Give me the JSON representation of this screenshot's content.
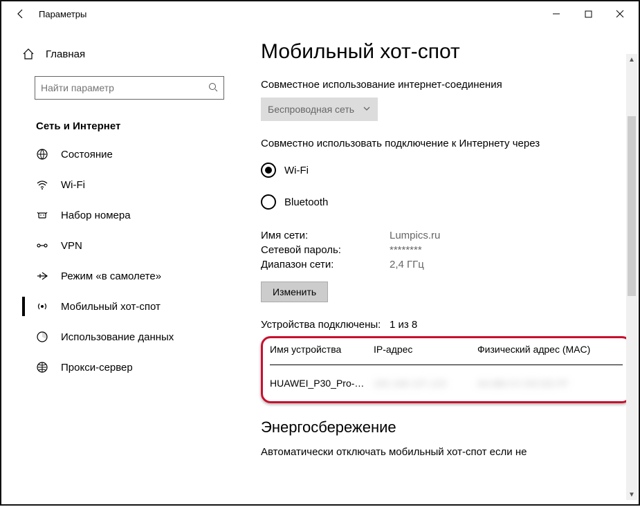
{
  "window": {
    "title": "Параметры"
  },
  "sidebar": {
    "home": "Главная",
    "search_placeholder": "Найти параметр",
    "category": "Сеть и Интернет",
    "items": [
      {
        "label": "Состояние",
        "iconKey": "status"
      },
      {
        "label": "Wi-Fi",
        "iconKey": "wifi"
      },
      {
        "label": "Набор номера",
        "iconKey": "dialup"
      },
      {
        "label": "VPN",
        "iconKey": "vpn"
      },
      {
        "label": "Режим «в самолете»",
        "iconKey": "airplane"
      },
      {
        "label": "Мобильный хот-спот",
        "iconKey": "hotspot"
      },
      {
        "label": "Использование данных",
        "iconKey": "datausage"
      },
      {
        "label": "Прокси-сервер",
        "iconKey": "proxy"
      }
    ]
  },
  "main": {
    "title": "Мобильный хот-спот",
    "share_connection_label": "Совместное использование интернет-соединения",
    "share_connection_value": "Беспроводная сеть",
    "share_over_label": "Совместно использовать подключение к Интернету через",
    "share_over_options": [
      {
        "label": "Wi-Fi",
        "selected": true
      },
      {
        "label": "Bluetooth",
        "selected": false
      }
    ],
    "network": {
      "name_label": "Имя сети:",
      "name_value": "Lumpics.ru",
      "password_label": "Сетевой пароль:",
      "password_value": "********",
      "band_label": "Диапазон сети:",
      "band_value": "2,4 ГГц",
      "edit_button": "Изменить"
    },
    "devices": {
      "connected_label": "Устройства подключены:",
      "connected_value": "1 из 8",
      "headers": {
        "name": "Имя устройства",
        "ip": "IP-адрес",
        "mac": "Физический адрес (MAC)"
      },
      "rows": [
        {
          "name": "HUAWEI_P30_Pro-…",
          "ip": "•••",
          "mac": "•••"
        }
      ]
    },
    "power_section_title": "Энергосбережение",
    "power_description": "Автоматически отключать мобильный хот-спот если не"
  }
}
